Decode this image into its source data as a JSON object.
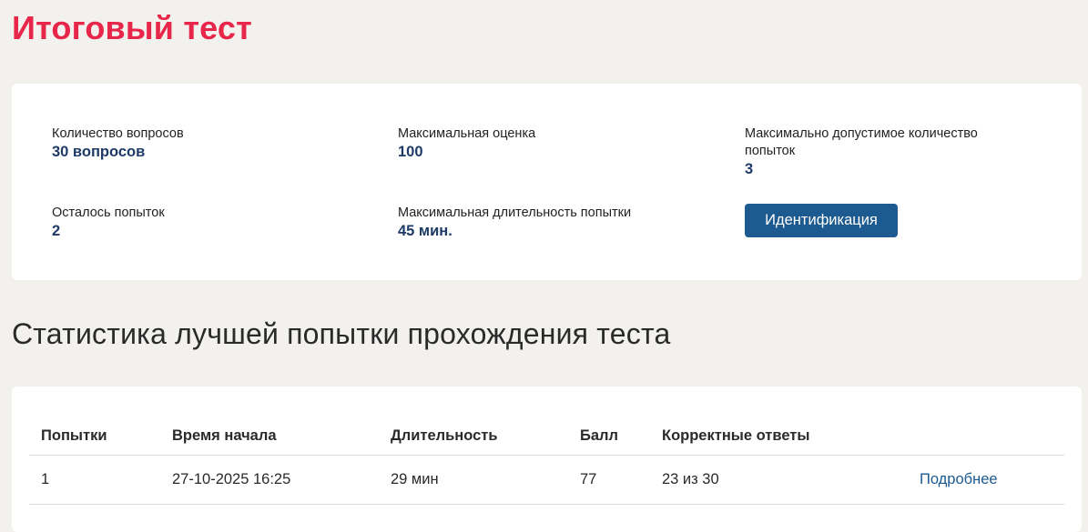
{
  "page": {
    "title": "Итоговый тест"
  },
  "info": {
    "questions_label": "Количество вопросов",
    "questions_value": "30 вопросов",
    "max_score_label": "Максимальная оценка",
    "max_score_value": "100",
    "max_attempts_label": "Максимально допустимое количество попыток",
    "max_attempts_value": "3",
    "remaining_label": "Осталось попыток",
    "remaining_value": "2",
    "max_duration_label": "Максимальная длительность попытки",
    "max_duration_value": "45 мин.",
    "ident_button_label": "Идентификация"
  },
  "stats": {
    "heading": "Статистика лучшей попытки прохождения теста",
    "columns": [
      "Попытки",
      "Время начала",
      "Длительность",
      "Балл",
      "Корректные ответы",
      ""
    ],
    "rows": [
      {
        "attempt": "1",
        "start_time": "27-10-2025 16:25",
        "duration": "29 мин",
        "score": "77",
        "correct": "23 из 30",
        "details_label": "Подробнее"
      }
    ]
  },
  "colors": {
    "title": "#e8264a",
    "value": "#1e3a66",
    "button": "#1d5a90",
    "link": "#1d5a90",
    "background": "#f2f1ee"
  }
}
